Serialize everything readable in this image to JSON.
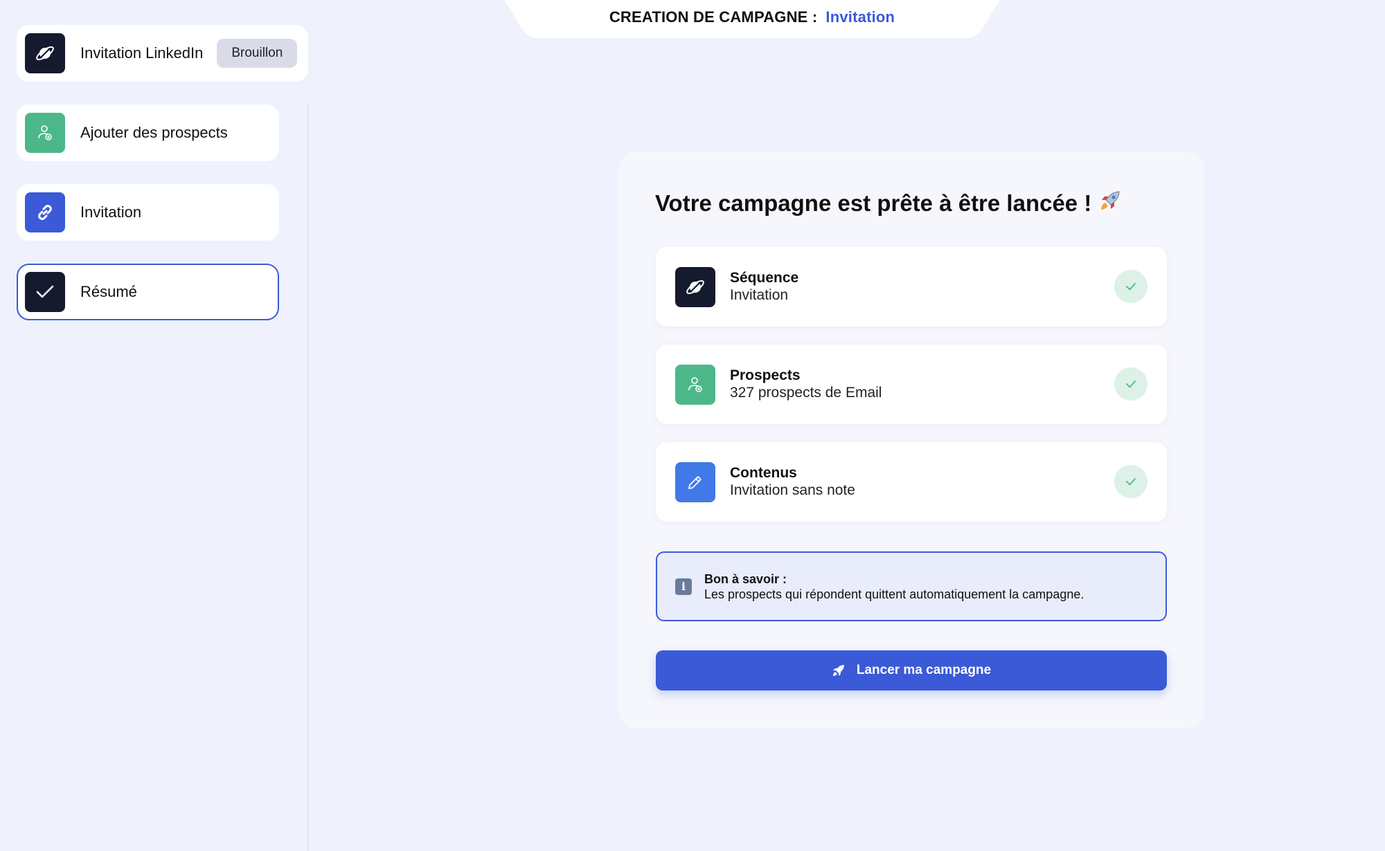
{
  "header": {
    "prefix": "CREATION DE CAMPAGNE :",
    "campaign_name": "Invitation"
  },
  "sidebar": {
    "campaign": {
      "name": "Invitation LinkedIn",
      "status": "Brouillon",
      "icon": "planet-icon"
    },
    "steps": [
      {
        "label": "Ajouter des prospects",
        "icon": "user-plus-icon",
        "active": false
      },
      {
        "label": "Invitation",
        "icon": "link-icon",
        "active": false
      },
      {
        "label": "Résumé",
        "icon": "check-icon",
        "active": true
      }
    ]
  },
  "main": {
    "title": "Votre campagne est prête à être lancée !",
    "title_icon": "rocket-icon",
    "summary": [
      {
        "title": "Séquence",
        "subtitle": "Invitation",
        "icon": "planet-icon",
        "status": "check-icon"
      },
      {
        "title": "Prospects",
        "subtitle": "327 prospects de Email",
        "icon": "user-plus-icon",
        "status": "check-icon"
      },
      {
        "title": "Contenus",
        "subtitle": "Invitation sans note",
        "icon": "pencil-icon",
        "status": "check-icon"
      }
    ],
    "info": {
      "title": "Bon à savoir :",
      "body": "Les prospects qui répondent quittent automatiquement la campagne.",
      "icon": "info-icon"
    },
    "launch_button": {
      "label": "Lancer ma campagne",
      "icon": "rocket-icon"
    }
  },
  "colors": {
    "background": "#eff2fc",
    "accent": "#3a5ad8",
    "dark": "#161a2e",
    "green": "#4cb88a",
    "check_bg": "#ddf1e8"
  }
}
